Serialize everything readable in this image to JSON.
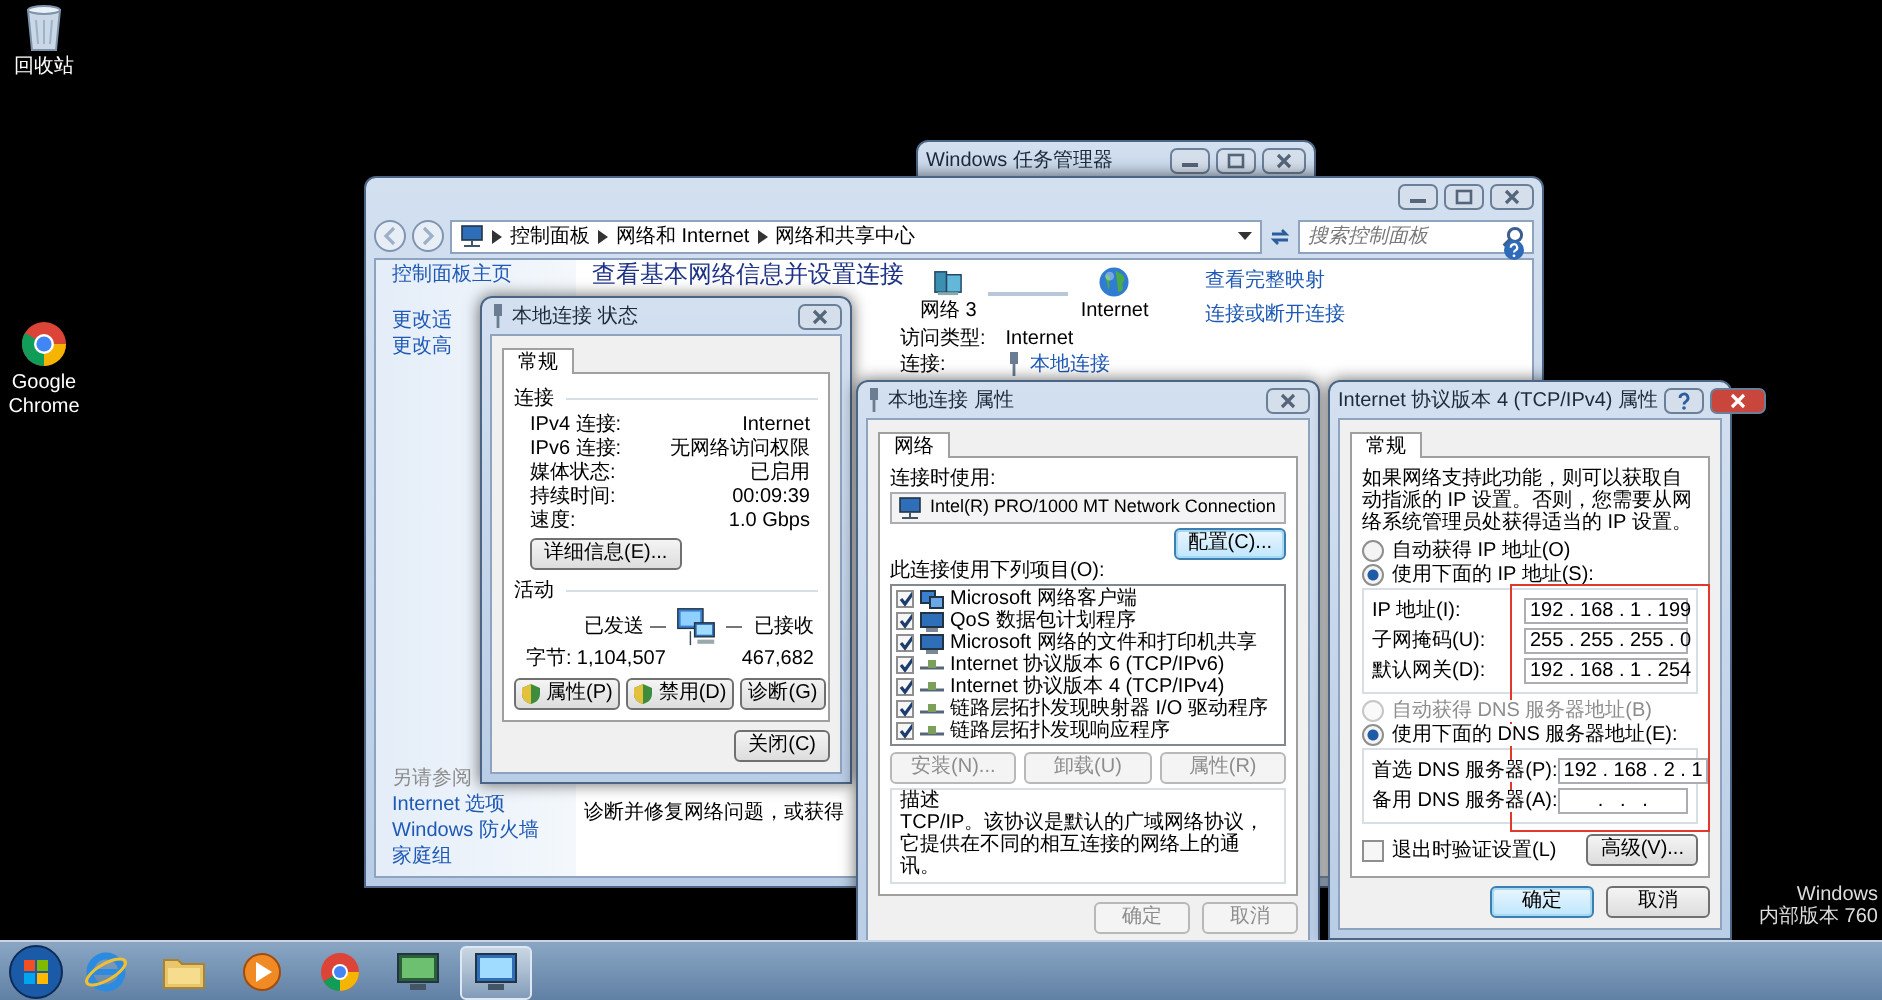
{
  "desktop_icons": [
    {
      "label": "回收站",
      "kind": "recycle-bin"
    },
    {
      "label": "Google Chrome",
      "kind": "chrome"
    }
  ],
  "os_notice": [
    "Windows",
    "内部版本 760"
  ],
  "task_manager": {
    "title": "Windows 任务管理器"
  },
  "network_center": {
    "breadcrumbs": [
      "控制面板",
      "网络和 Internet",
      "网络和共享中心"
    ],
    "search": {
      "placeholder": "搜索控制面板"
    },
    "sidebar": {
      "items": [
        "控制面板主页",
        "更改适",
        "更改高"
      ],
      "see_also_title": "另请参阅",
      "see_also": [
        "Internet 选项",
        "Windows 防火墙",
        "家庭组"
      ]
    },
    "heading": "查看基本网络信息并设置连接",
    "map": {
      "network": "网络 3",
      "internet": "Internet",
      "full_map_link": "查看完整映射"
    },
    "connect_link": "连接或断开连接",
    "access_type": {
      "label": "访问类型:",
      "value": "Internet"
    },
    "connection": {
      "label": "连接:",
      "value": "本地连接"
    },
    "troubleshoot": "诊断并修复网络问题，或获得"
  },
  "status_dialog": {
    "title": "本地连接 状态",
    "tabs": [
      {
        "label": "常规",
        "selected": true
      }
    ],
    "connection_section": "连接",
    "connection_rows": [
      {
        "label": "IPv4 连接:",
        "value": "Internet"
      },
      {
        "label": "IPv6 连接:",
        "value": "无网络访问权限"
      },
      {
        "label": "媒体状态:",
        "value": "已启用"
      },
      {
        "label": "持续时间:",
        "value": "00:09:39"
      },
      {
        "label": "速度:",
        "value": "1.0 Gbps"
      }
    ],
    "details_button": "详细信息(E)...",
    "activity_section": "活动",
    "sent_label": "已发送",
    "received_label": "已接收",
    "bytes_label": "字节:",
    "bytes_sent": "1,104,507",
    "bytes_received": "467,682",
    "buttons": [
      {
        "label": "属性(P)",
        "kind": "shield"
      },
      {
        "label": "禁用(D)",
        "kind": "shield"
      },
      {
        "label": "诊断(G)",
        "kind": "plain"
      }
    ],
    "close_button": "关闭(C)"
  },
  "properties_dialog": {
    "title": "本地连接 属性",
    "tabs": [
      {
        "label": "网络",
        "selected": true
      }
    ],
    "connect_using_label": "连接时使用:",
    "adapter": "Intel(R) PRO/1000 MT Network Connection",
    "configure_button": "配置(C)...",
    "items_label": "此连接使用下列项目(O):",
    "items": [
      {
        "label": "Microsoft 网络客户端",
        "checked": true,
        "kind": "client"
      },
      {
        "label": "QoS 数据包计划程序",
        "checked": true,
        "kind": "service"
      },
      {
        "label": "Microsoft 网络的文件和打印机共享",
        "checked": true,
        "kind": "service"
      },
      {
        "label": "Internet 协议版本 6 (TCP/IPv6)",
        "checked": true,
        "kind": "protocol"
      },
      {
        "label": "Internet 协议版本 4 (TCP/IPv4)",
        "checked": true,
        "kind": "protocol"
      },
      {
        "label": "链路层拓扑发现映射器 I/O 驱动程序",
        "checked": true,
        "kind": "protocol"
      },
      {
        "label": "链路层拓扑发现响应程序",
        "checked": true,
        "kind": "protocol"
      }
    ],
    "item_buttons": [
      {
        "label": "安装(N)...",
        "disabled": true
      },
      {
        "label": "卸载(U)",
        "disabled": true
      },
      {
        "label": "属性(R)",
        "disabled": true
      }
    ],
    "description_label": "描述",
    "description": "TCP/IP。该协议是默认的广域网络协议，它提供在不同的相互连接的网络上的通讯。",
    "footer_buttons": [
      {
        "label": "确定",
        "disabled": true
      },
      {
        "label": "取消",
        "disabled": true
      }
    ]
  },
  "ipv4_dialog": {
    "title": "Internet 协议版本 4 (TCP/IPv4) 属性",
    "tabs": [
      {
        "label": "常规",
        "selected": true
      }
    ],
    "intro": "如果网络支持此功能，则可以获取自动指派的 IP 设置。否则，您需要从网络系统管理员处获得适当的 IP 设置。",
    "ip_mode": [
      {
        "label": "自动获得 IP 地址(O)",
        "selected": false,
        "disabled": false
      },
      {
        "label": "使用下面的 IP 地址(S):",
        "selected": true,
        "disabled": false
      }
    ],
    "ip_fields": [
      {
        "label": "IP 地址(I):",
        "value": "192 . 168 . 1 . 199"
      },
      {
        "label": "子网掩码(U):",
        "value": "255 . 255 . 255 . 0"
      },
      {
        "label": "默认网关(D):",
        "value": "192 . 168 . 1 . 254"
      }
    ],
    "dns_mode": [
      {
        "label": "自动获得 DNS 服务器地址(B)",
        "selected": false,
        "disabled": true
      },
      {
        "label": "使用下面的 DNS 服务器地址(E):",
        "selected": true,
        "disabled": false
      }
    ],
    "dns_fields": [
      {
        "label": "首选 DNS 服务器(P):",
        "value": "192 . 168 . 2 . 1"
      },
      {
        "label": "备用 DNS 服务器(A):",
        "value": ".   .   ."
      }
    ],
    "validate": {
      "label": "退出时验证设置(L)",
      "checked": false
    },
    "advanced_button": "高级(V)...",
    "ok_button": "确定",
    "cancel_button": "取消"
  },
  "taskbar": {
    "items": [
      {
        "kind": "ie",
        "selected": false
      },
      {
        "kind": "explorer",
        "selected": false
      },
      {
        "kind": "media",
        "selected": false
      },
      {
        "kind": "chrome",
        "selected": false
      },
      {
        "kind": "monitor",
        "selected": false
      },
      {
        "kind": "control-panel",
        "selected": true
      }
    ]
  }
}
